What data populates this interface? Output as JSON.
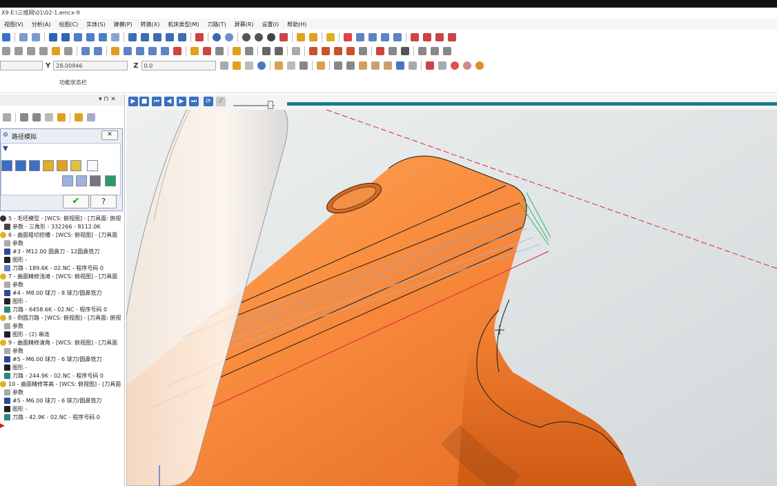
{
  "window": {
    "title": "X9  E:\\三维网\\01\\02-1.emcx-9"
  },
  "menu": [
    "视图(V)",
    "分析(A)",
    "绘图(C)",
    "实体(S)",
    "建模(P)",
    "转换(X)",
    "机床类型(M)",
    "刀路(T)",
    "屏幕(R)",
    "设置(I)",
    "帮助(H)"
  ],
  "coords": {
    "y_label": "Y",
    "y_value": "28.00946",
    "z_label": "Z",
    "z_value": "0.0"
  },
  "func_status": "功能状态栏",
  "panel": {
    "pin": "▾ ⊓ ✕"
  },
  "dialog": {
    "title": "路径模拟",
    "close": "✕",
    "ok": "✔",
    "help": "?"
  },
  "tree": [
    "5 - 毛坯模型 - [WCS: 俯视图] - [刀具面: 俯视",
    "参数 - 三角形 - 332266 - 8112.0K",
    "6 - 曲面粗切挖槽 - [WCS: 俯视图] - [刀具面",
    "参数",
    "#3 - M12.00 圆鼻刀 - 12圆鼻铣刀",
    "图形 -",
    "刀路 - 189.6K - 02.NC - 程序号码 0",
    "7 - 曲面精修浅滩 - [WCS: 俯视图] - [刀具面",
    "参数",
    "#4 - M8.00 球刀 - 8 球刀/圆鼻铣刀",
    "图形 -",
    "刀路 - 6458.6K - 02.NC - 程序号码 0",
    "8 - 倒圆刀路 - [WCS: 俯视图] - [刀具面: 俯视",
    "参数",
    "图形 - (2) 串连",
    "9 - 曲面精修清角 - [WCS: 俯视图] - [刀具面",
    "参数",
    "#5 - M6.00 球刀 - 6 球刀/圆鼻铣刀",
    "图形 -",
    "刀路 - 244.9K - 02.NC - 程序号码 0",
    "10 - 曲面精修等高 - [WCS: 俯视图] - [刀具面",
    "参数",
    "#5 - M6.00 球刀 - 6 球刀/圆鼻铣刀",
    "图形 -",
    "刀路 - 42.9K - 02.NC - 程序号码 0"
  ],
  "colors": {
    "accent": "#1a7e84",
    "part": "#f2852f",
    "toolpath_green": "#2db36a",
    "toolpath_red": "#e0203a"
  }
}
